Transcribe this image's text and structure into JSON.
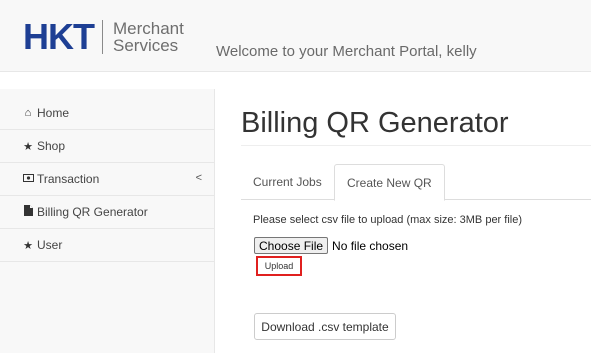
{
  "header": {
    "logo_brand": "HKT",
    "logo_line1": "Merchant",
    "logo_line2": "Services",
    "welcome": "Welcome to your Merchant Portal, kelly"
  },
  "sidebar": {
    "items": [
      {
        "label": "Home",
        "icon": "home-icon"
      },
      {
        "label": "Shop",
        "icon": "star-icon"
      },
      {
        "label": "Transaction",
        "icon": "money-icon",
        "chevron": "<"
      },
      {
        "label": "Billing QR Generator",
        "icon": "file-icon"
      },
      {
        "label": "User",
        "icon": "star-icon"
      }
    ]
  },
  "main": {
    "title": "Billing QR Generator",
    "tabs": [
      {
        "label": "Current Jobs",
        "active": false
      },
      {
        "label": "Create New QR",
        "active": true
      }
    ],
    "instruction": "Please select csv file to upload (max size: 3MB per file)",
    "choose_file_label": "Choose File",
    "no_file_text": "No file chosen",
    "upload_label": "Upload",
    "download_label": "Download .csv template"
  },
  "colors": {
    "brand_blue": "#1e3f94",
    "highlight_red": "#e0201f"
  }
}
